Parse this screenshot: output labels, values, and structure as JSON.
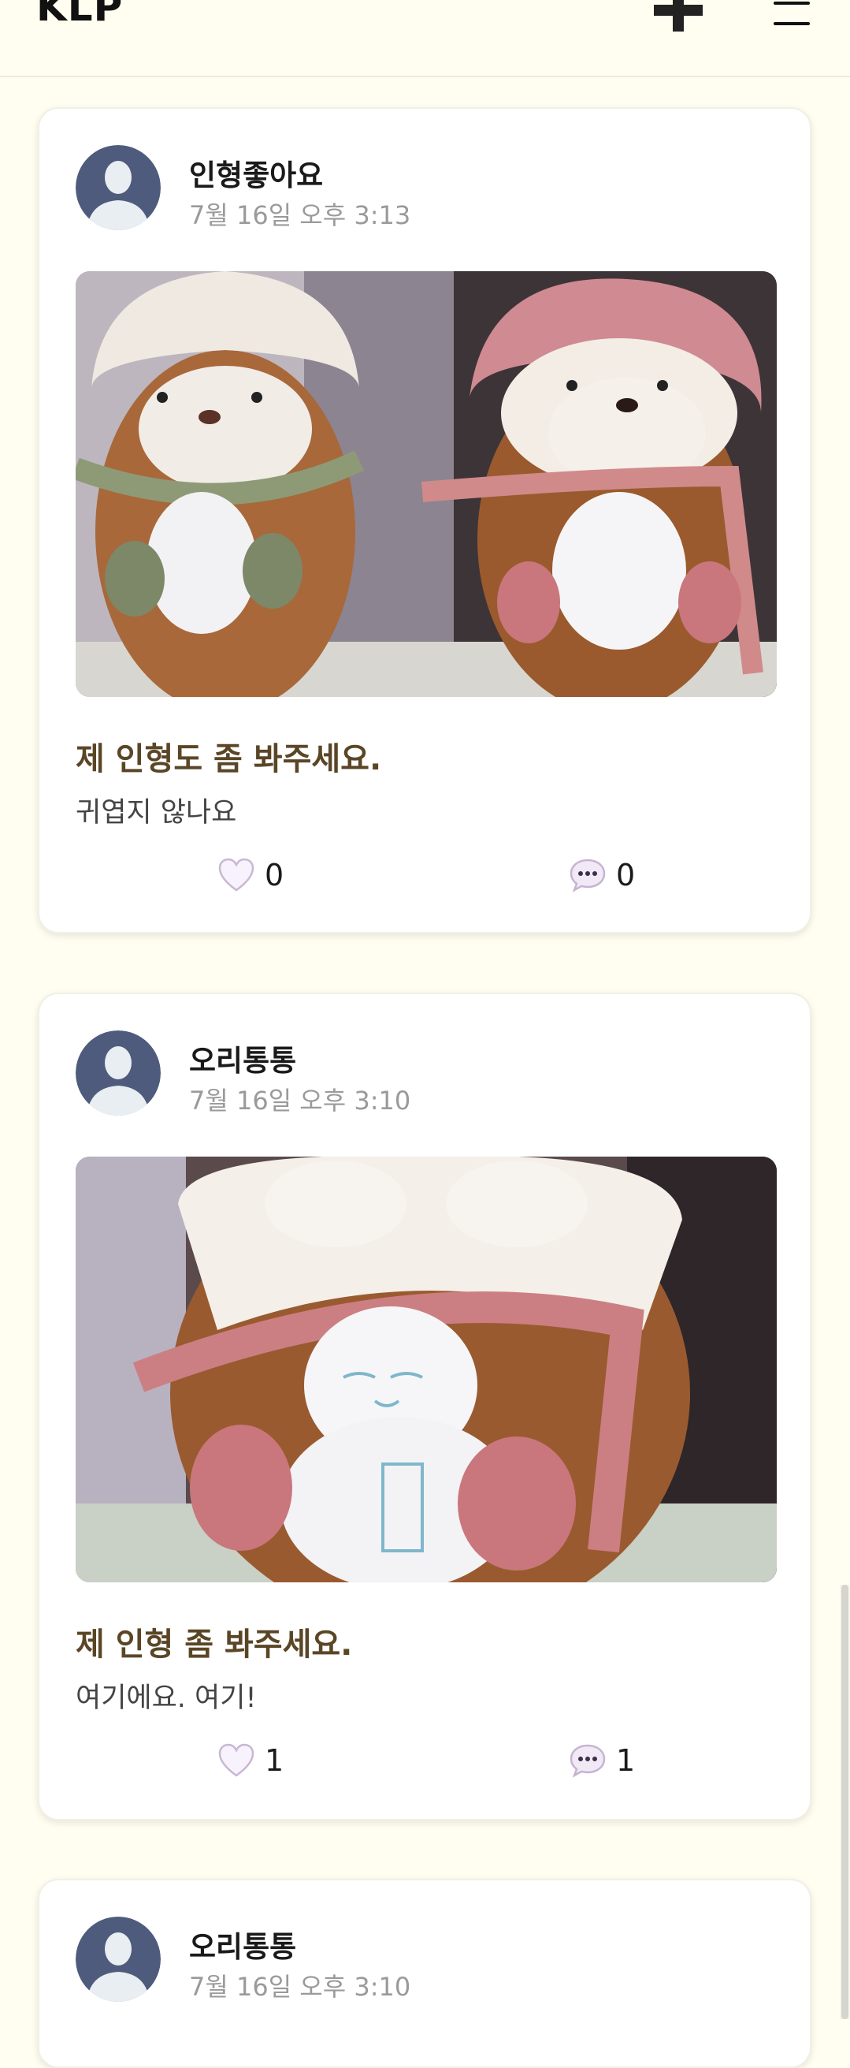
{
  "app": {
    "logo": "KLP"
  },
  "header": {
    "add_icon": "plus-icon",
    "menu_icon": "hamburger-menu-icon"
  },
  "colors": {
    "background": "#fffef0",
    "title_brown": "#5a4626",
    "avatar": "#4f5b7c"
  },
  "posts": [
    {
      "author": "인형좋아요",
      "timestamp": "7월 16일 오후 3:13",
      "image": "two plush otter dolls in winter hats and scarves",
      "title": "제 인형도 좀 봐주세요.",
      "body": "귀엽지 않나요",
      "likes": "0",
      "comments": "0"
    },
    {
      "author": "오리통통",
      "timestamp": "7월 16일 오후 3:10",
      "image": "close-up of plush doll holding a small snowman",
      "title": "제 인형 좀 봐주세요.",
      "body": "여기에요. 여기!",
      "likes": "1",
      "comments": "1"
    },
    {
      "author": "오리통통",
      "timestamp": "7월 16일 오후 3:10"
    }
  ]
}
